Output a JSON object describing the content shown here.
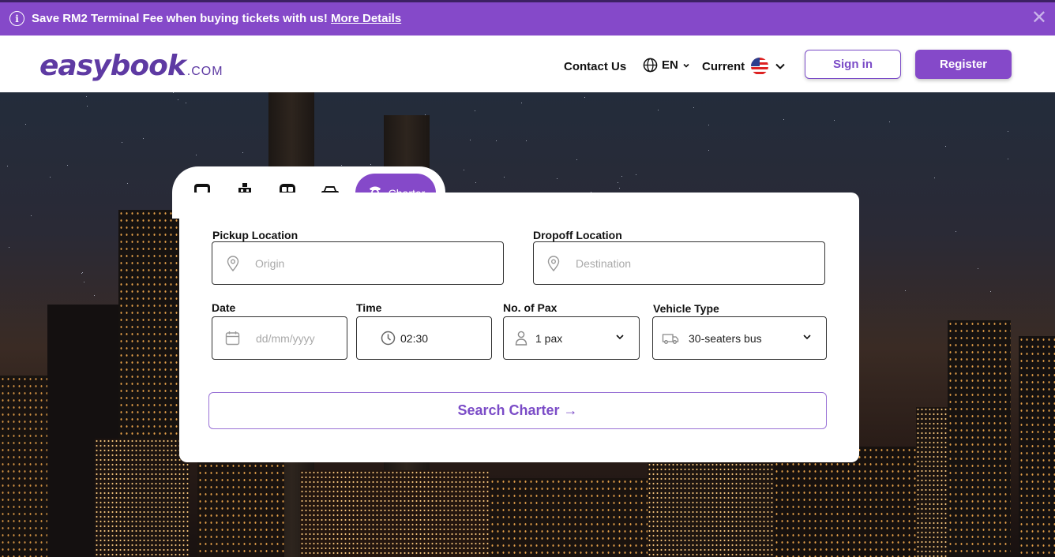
{
  "promo": {
    "message": "Save RM2 Terminal Fee when buying tickets with us!",
    "link": "More Details",
    "info_glyph": "i",
    "close_glyph": "✕"
  },
  "header": {
    "logo_word": "easybook",
    "logo_tld": ".COM",
    "contact": "Contact Us",
    "language": "EN",
    "currency": "Current",
    "sign_in": "Sign in",
    "register": "Register"
  },
  "tabs": {
    "items": [
      {
        "icon": "bus-icon"
      },
      {
        "icon": "ferry-icon"
      },
      {
        "icon": "train-icon"
      },
      {
        "icon": "car-icon"
      }
    ],
    "active": {
      "icon": "driver-icon",
      "label": "Charter"
    }
  },
  "form": {
    "pickup": {
      "label": "Pickup Location",
      "placeholder": "Origin"
    },
    "dropoff": {
      "label": "Dropoff Location",
      "placeholder": "Destination"
    },
    "date": {
      "label": "Date",
      "placeholder": "dd/mm/yyyy"
    },
    "time": {
      "label": "Time",
      "value": "02:30"
    },
    "pax": {
      "label": "No. of Pax",
      "value": "1 pax"
    },
    "vehicle": {
      "label": "Vehicle Type",
      "value": "30-seaters bus"
    },
    "search": "Search Charter →"
  },
  "colors": {
    "brand": "#8549c9",
    "brand_dark": "#5e3aa3",
    "promo_bg": "#8549c9"
  }
}
